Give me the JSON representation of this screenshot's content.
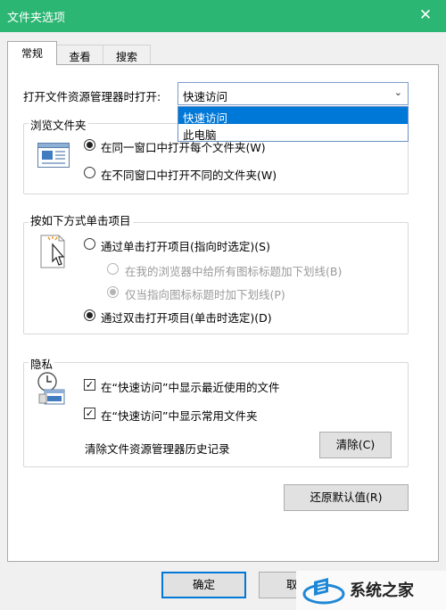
{
  "window": {
    "title": "文件夹选项",
    "close_glyph": "✕"
  },
  "tabs": [
    {
      "label": "常规"
    },
    {
      "label": "查看"
    },
    {
      "label": "搜索"
    }
  ],
  "open_explorer": {
    "label": "打开文件资源管理器时打开:",
    "selected": "快速访问",
    "options": [
      "快速访问",
      "此电脑"
    ]
  },
  "browse_folders": {
    "title": "浏览文件夹",
    "opt_same": "在同一窗口中打开每个文件夹(W)",
    "opt_new": "在不同窗口中打开不同的文件夹(W)"
  },
  "click_items": {
    "title": "按如下方式单击项目",
    "opt_single": "通过单击打开项目(指向时选定)(S)",
    "sub_underline_all": "在我的浏览器中给所有图标标题加下划线(B)",
    "sub_underline_point": "仅当指向图标标题时加下划线(P)",
    "opt_double": "通过双击打开项目(单击时选定)(D)"
  },
  "privacy": {
    "title": "隐私",
    "show_recent": "在“快速访问”中显示最近使用的文件",
    "show_frequent": "在“快速访问”中显示常用文件夹",
    "clear_history_label": "清除文件资源管理器历史记录",
    "clear_button": "清除(C)",
    "check_glyph": "✓"
  },
  "restore_defaults": "还原默认值(R)",
  "footer": {
    "ok": "确定",
    "cancel_partial": "取"
  },
  "watermark": {
    "text": "系统之家"
  }
}
